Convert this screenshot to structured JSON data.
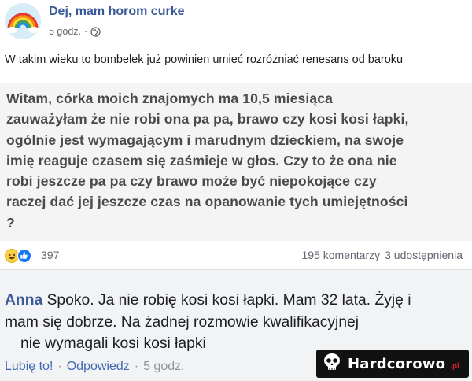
{
  "post": {
    "author": "Dej, mam horom curke",
    "time": "5 godz.",
    "separator": "·",
    "caption": "W takim wieku to bombelek już powinien umieć rozróżniać renesans od baroku"
  },
  "screenshot": {
    "lines": [
      "Witam, córka moich znajomych ma 10,5 miesiąca",
      "zauważyłam że nie robi ona pa pa, brawo czy kosi kosi łapki,",
      "ogólnie jest wymagającym i marudnym dzieckiem, na swoje",
      "imię reaguje czasem się zaśmieje w głos. Czy to że ona nie",
      "robi jeszcze pa pa czy brawo może być niepokojące czy",
      "raczej dać jej jeszcze czas na opanowanie tych umiejętności",
      "?"
    ]
  },
  "reactions": {
    "count": "397",
    "comments": "195 komentarzy",
    "shares": "3 udostępnienia"
  },
  "comment": {
    "author": "Anna",
    "line1": "Spoko. Ja nie robię kosi kosi łapki. Mam 32 lata. Żyję i",
    "line2": "mam się dobrze. Na żadnej rozmowie kwalifikacyjnej",
    "line3": "nie wymagali kosi kosi łapki",
    "like": "Lubię to!",
    "reply": "Odpowiedz",
    "time": "5 godz.",
    "separator": "·"
  },
  "watermark": {
    "text": "Hardcorowo",
    "suffix": ".pl"
  },
  "colors": {
    "link": "#385898",
    "action": "#4267b2",
    "like_reaction": "#1877f2",
    "haha_reaction": "#f7d046",
    "comment_bg": "#f2f3f5"
  },
  "icons": [
    "rainbow-avatar-icon",
    "globe-icon",
    "haha-reaction-icon",
    "like-reaction-icon",
    "skull-logo-icon"
  ]
}
